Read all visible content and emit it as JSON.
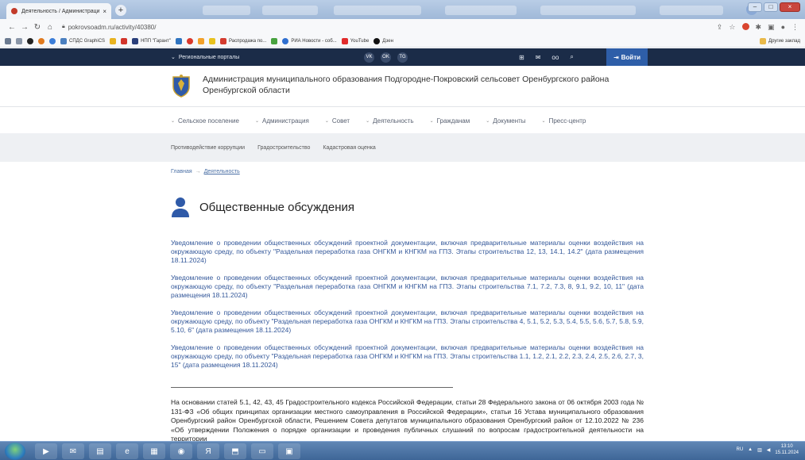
{
  "browser": {
    "tab_title": "Деятельность / Администраци",
    "tab_close": "×",
    "new_tab": "+",
    "url": "pokrovsoadm.ru/activity/40380/",
    "bookmarks": [
      "СПДС GraphiCS",
      "НПП \"Гарант\"",
      "Распродажа по...",
      "РИА Новости - соб...",
      "YouTube",
      "Дзен"
    ],
    "other_bookmarks": "Другие заклад"
  },
  "topbar": {
    "regional_label": "Региональные порталы",
    "social": [
      "VK",
      "OK",
      "TG"
    ],
    "login_label": "Войти",
    "tools": [
      "sitemap-icon",
      "mail-icon",
      "accessibility-icon",
      "search-icon"
    ]
  },
  "brand": {
    "title": "Администрация муниципального образования Подгородне-Покровский сельсовет Оренбургского района Оренбургской области"
  },
  "menu": {
    "items": [
      "Сельское поселение",
      "Администрация",
      "Совет",
      "Деятельность",
      "Гражданам",
      "Документы",
      "Пресс-центр"
    ]
  },
  "submenu": {
    "items": [
      "Противодействие коррупции",
      "Градостроительство",
      "Кадастровая оценка"
    ]
  },
  "breadcrumb": {
    "home": "Главная",
    "separator": "→",
    "current": "Деятельность"
  },
  "page": {
    "title": "Общественные обсуждения"
  },
  "notices": [
    {
      "text": "Уведомление о проведении общественных обсуждений проектной документации, включая предварительные материалы оценки воздействия на окружающую среду, по объекту \"Раздельная переработка газа ОНГКМ и КНГКМ на ГПЗ. Этапы строительства 12, 13, 14.1, 14.2\" (дата размещения 18.11.2024)"
    },
    {
      "text": "Уведомление о проведении общественных обсуждений проектной документации, включая предварительные материалы оценки воздействия на окружающую среду, по объекту \"Раздельная переработка газа ОНГКМ и КНГКМ на ГПЗ. Этапы строительства 7.1, 7.2, 7.3, 8, 9.1, 9.2, 10, 11\" (дата размещения 18.11.2024)"
    },
    {
      "text": "Уведомление о проведении общественных обсуждений проектной документации, включая предварительные материалы оценки воздействия на окружающую среду, по объекту \"Раздельная переработка газа ОНГКМ и КНГКМ на ГПЗ. Этапы строительства 4, 5.1, 5.2, 5.3, 5.4, 5.5, 5.6, 5.7, 5.8, 5.9, 5.10, 6\" (дата размещения 18.11.2024)"
    },
    {
      "text": "Уведомление о проведении общественных обсуждений проектной документации, включая предварительные материалы оценки воздействия на окружающую среду, по объекту \"Раздельная переработка газа ОНГКМ и КНГКМ на ГПЗ. Этапы строительства 1.1, 1.2, 2.1, 2.2, 2.3, 2.4, 2.5, 2.6, 2.7, 3, 15\" (дата размещения 18.11.2024)"
    }
  ],
  "legal_text": "На основании статей 5.1, 42, 43, 45 Градостроительного кодекса Российской Федерации, статьи 28 Федерального закона от 06 октября 2003 года № 131-ФЗ «Об общих принципах организации местного самоуправления в Российской Федерации», статьи 16 Устава муниципального образования Оренбургский район Оренбургской области, Решением Совета депутатов муниципального образования Оренбургский район от 12.10.2022 № 236 «Об утверждении Положения о порядке организации и проведения публичных слушаний по вопросам градостроительной деятельности на территории",
  "taskbar": {
    "lang": "RU",
    "time": "13:10",
    "date": "15.11.2024"
  },
  "colors": {
    "topbar": "#1b2c48",
    "login": "#2e5ea8",
    "link": "#34589a"
  }
}
